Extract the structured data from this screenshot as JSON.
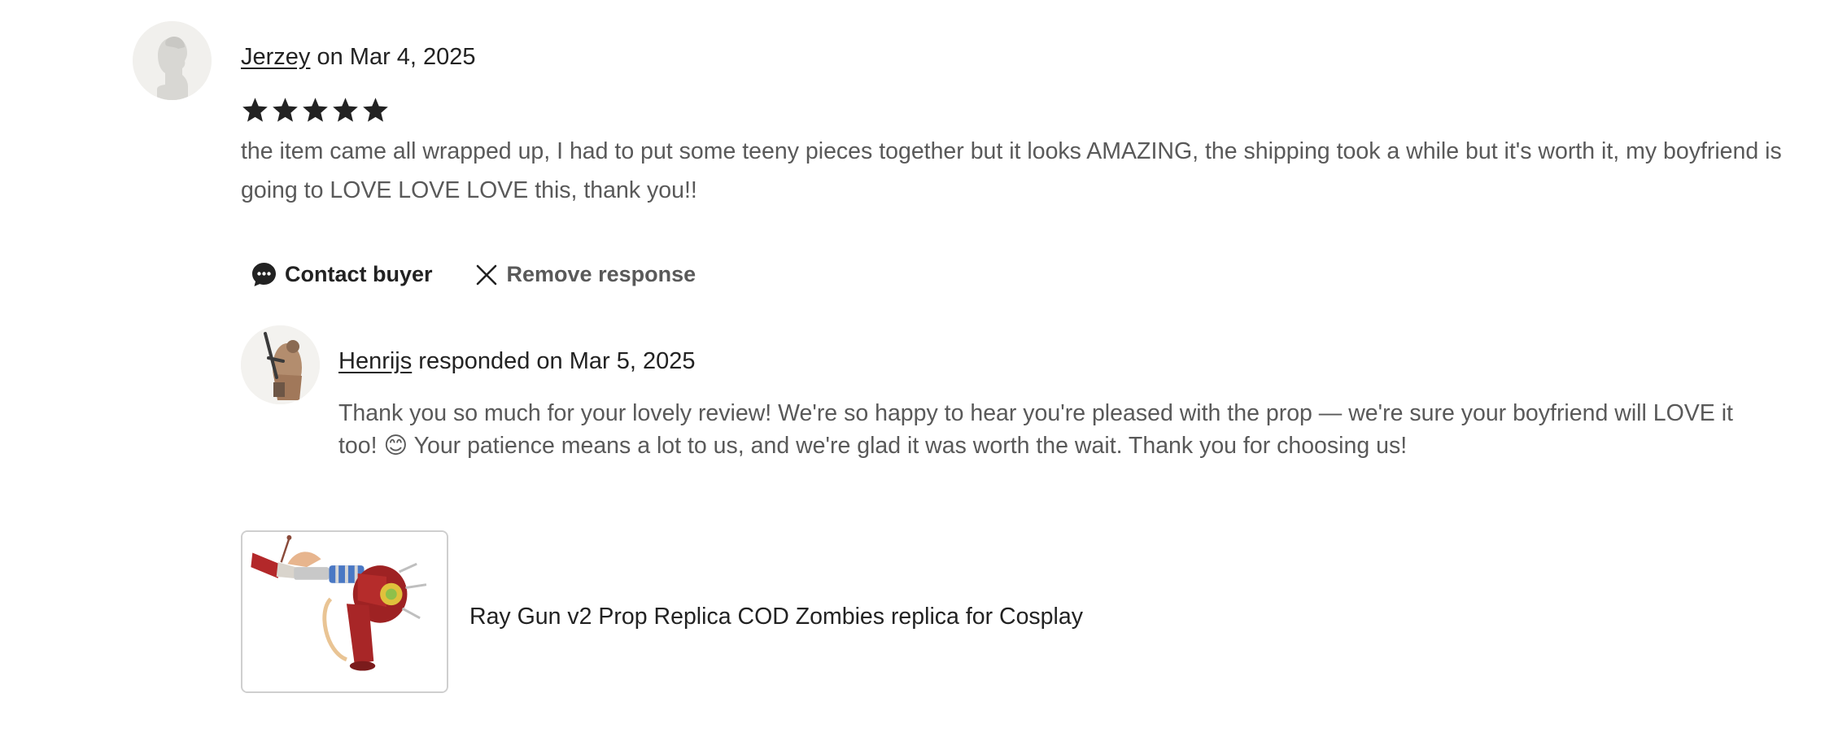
{
  "review": {
    "reviewer_name": "Jerzey",
    "date_text": " on Mar 4, 2025",
    "rating": 5,
    "rating_max": 5,
    "text": "the item came all wrapped up, I had to put some teeny pieces together but it looks AMAZING, the shipping took a while but it's worth it, my boyfriend is going to LOVE LOVE LOVE this, thank you!!"
  },
  "actions": {
    "contact_label": "Contact buyer",
    "remove_label": "Remove response"
  },
  "response": {
    "seller_name": "Henrijs",
    "date_text": " responded on Mar 5, 2025",
    "text": "Thank you so much for your lovely review! We're so happy to hear you're pleased with the prop — we're sure your boyfriend will LOVE it too! 😊 Your patience means a lot to us, and we're glad it was worth the wait. Thank you for choosing us!"
  },
  "product": {
    "title": "Ray Gun v2 Prop Replica COD Zombies replica for Cosplay"
  },
  "colors": {
    "text_primary": "#222222",
    "text_secondary": "#595959",
    "star": "#222222",
    "thumb_border": "#cfcfcf"
  },
  "icons": {
    "contact": "chat-bubble-icon",
    "remove": "close-icon",
    "star": "star-icon"
  }
}
